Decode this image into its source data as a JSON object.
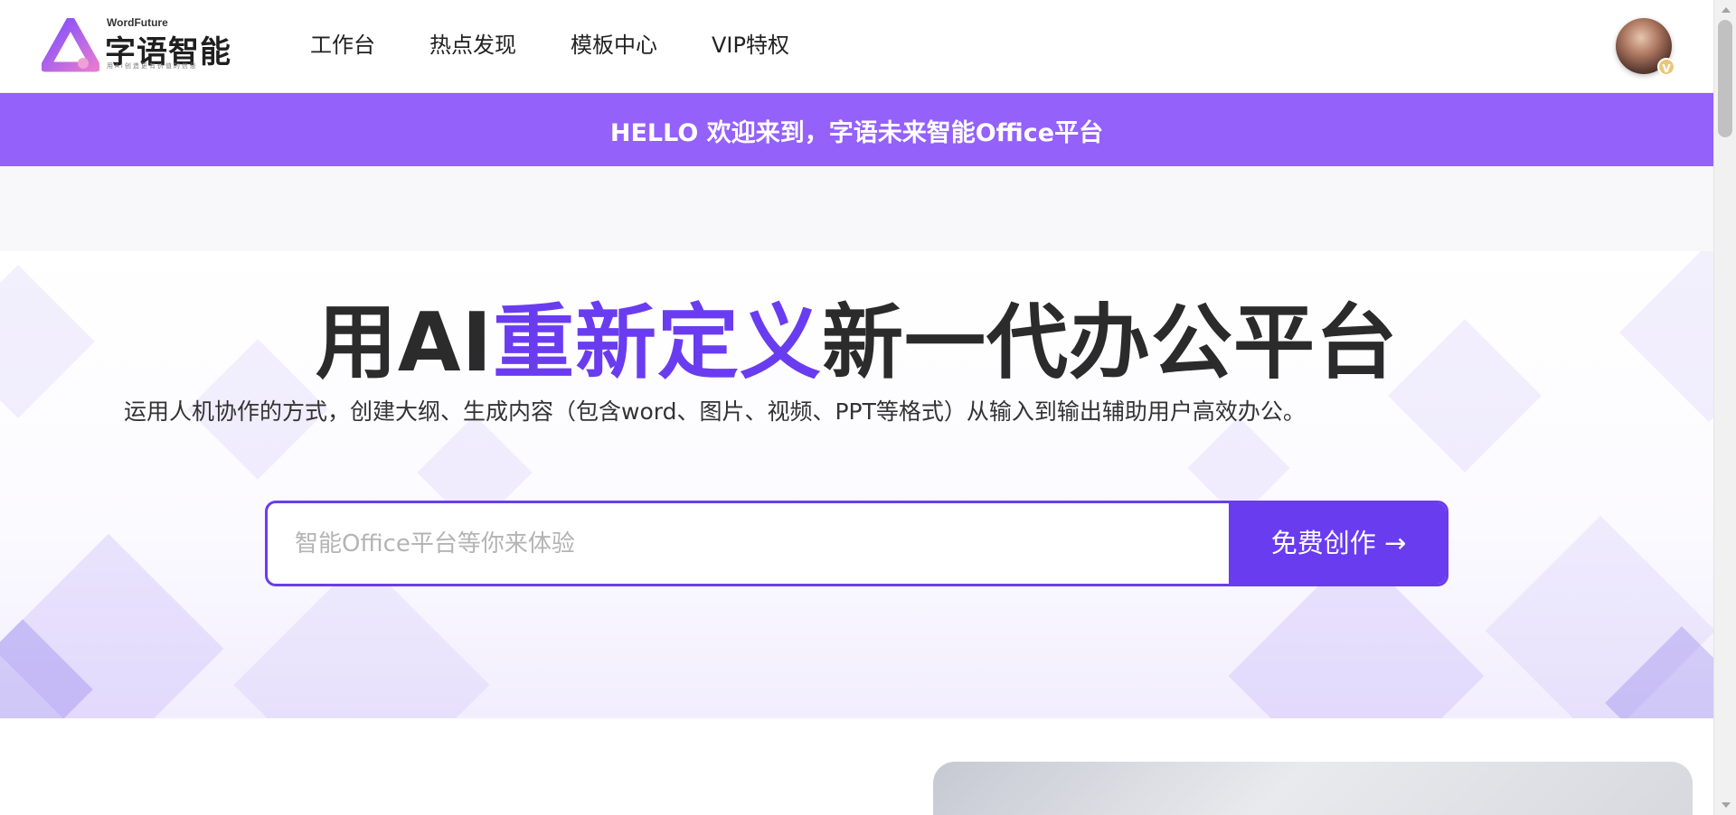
{
  "nav": {
    "brand_en": "WordFuture",
    "brand_cn": "字语智能",
    "brand_slogan": "用AI创造更有价值的信息",
    "menu": [
      {
        "label": "工作台"
      },
      {
        "label": "热点发现"
      },
      {
        "label": "模板中心"
      },
      {
        "label": "VIP特权"
      }
    ],
    "avatar_badge": "V"
  },
  "banner": {
    "text": "HELLO 欢迎来到，字语未来智能Office平台"
  },
  "hero": {
    "headline_pre": "用AI",
    "headline_highlight": "重新定义",
    "headline_post": "新一代办公平台",
    "subline": "运用人机协作的方式，创建大纲、生成内容（包含word、图片、视频、PPT等格式）从输入到输出辅助用户高效办公。",
    "search_placeholder": "智能Office平台等你来体验",
    "search_value": "",
    "cta_label": "免费创作 →"
  },
  "colors": {
    "brand_purple": "#6a3cf0",
    "banner_purple": "#9461fb"
  }
}
